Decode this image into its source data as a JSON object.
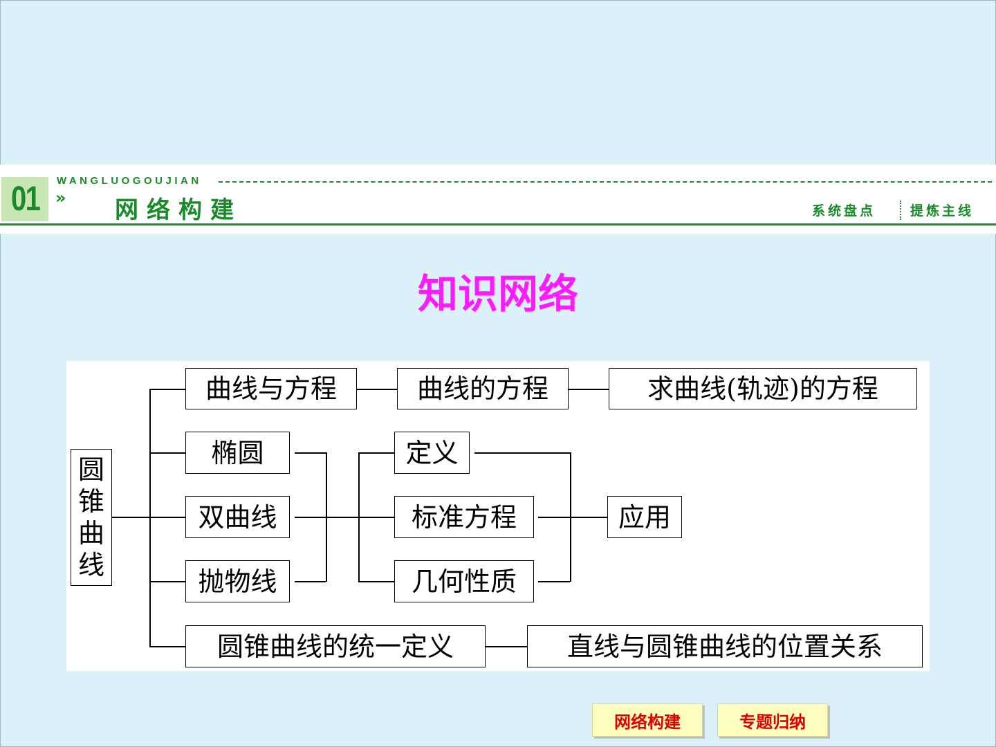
{
  "header": {
    "section_number": "01",
    "chevron": "»",
    "pinyin": "WANGLUOGOUJIAN",
    "section_title": "网络构建",
    "tagline_left": "系统盘点",
    "tagline_right": "提炼主线",
    "accent_color": "#1a8a2a"
  },
  "main_title": "知识网络",
  "diagram": {
    "root": [
      "圆",
      "锥",
      "曲",
      "线"
    ],
    "branch_curve_equation": "曲线与方程",
    "curve_equation": "曲线的方程",
    "find_trajectory": "求曲线(轨迹)的方程",
    "ellipse": "椭圆",
    "hyperbola": "双曲线",
    "parabola": "抛物线",
    "definition": "定义",
    "standard_equation": "标准方程",
    "geometric_properties": "几何性质",
    "application": "应用",
    "unified_definition": "圆锥曲线的统一定义",
    "line_conic_relation": "直线与圆锥曲线的位置关系"
  },
  "nav": {
    "network_build": "网络构建",
    "topic_summary": "专题归纳"
  }
}
